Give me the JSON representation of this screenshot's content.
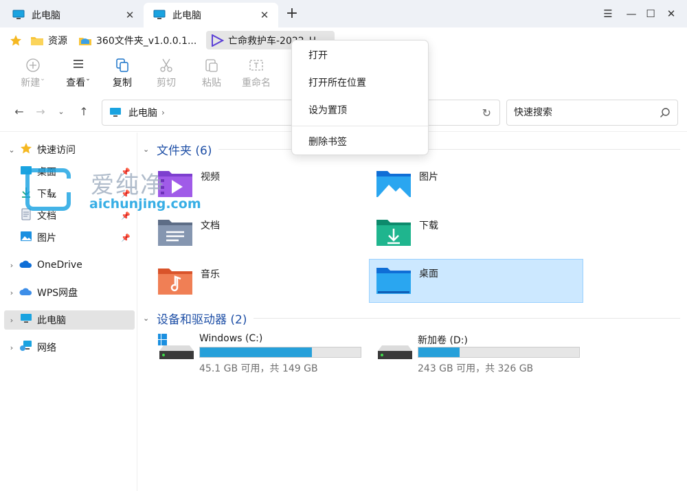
{
  "tabs": [
    {
      "label": "此电脑",
      "close": "✕"
    },
    {
      "label": "此电脑",
      "close": "✕"
    }
  ],
  "new_tab": "+",
  "window_controls": {
    "menu": "☰",
    "minimize": "—",
    "maximize": "☐",
    "close": "✕"
  },
  "bookmarks": [
    {
      "label": "资源",
      "icon": "folder-icon"
    },
    {
      "label": "360文件夹_v1.0.0.1...",
      "icon": "drive-folder-icon"
    },
    {
      "label": "亡命救护车-2022_H...",
      "icon": "video-icon"
    }
  ],
  "toolbar": {
    "new": "新建",
    "view": "查看",
    "copy": "复制",
    "cut": "剪切",
    "paste": "粘贴",
    "rename": "重命名"
  },
  "address": {
    "location": "此电脑",
    "separator": "›"
  },
  "search": {
    "placeholder": "快速搜索"
  },
  "sidebar": {
    "quick_access": "快速访问",
    "pinned": [
      {
        "label": "桌面"
      },
      {
        "label": "下载"
      },
      {
        "label": "文档"
      },
      {
        "label": "图片"
      }
    ],
    "onedrive": "OneDrive",
    "wps": "WPS网盘",
    "this_pc": "此电脑",
    "network": "网络"
  },
  "folders_section": {
    "title": "文件夹 (6)"
  },
  "folders": [
    {
      "name": "视频",
      "color": "#8c4bd9"
    },
    {
      "name": "图片",
      "color": "#1a8fe0"
    },
    {
      "name": "文档",
      "color": "#6d7f99"
    },
    {
      "name": "下载",
      "color": "#16a085"
    },
    {
      "name": "音乐",
      "color": "#e8673b"
    },
    {
      "name": "桌面",
      "color": "#1a8fe0"
    }
  ],
  "drives_section": {
    "title": "设备和驱动器 (2)"
  },
  "drives": [
    {
      "name": "Windows (C:)",
      "free_text": "45.1 GB 可用，共 149 GB",
      "used_fraction": 0.697
    },
    {
      "name": "新加卷 (D:)",
      "free_text": "243 GB 可用，共 326 GB",
      "used_fraction": 0.255
    }
  ],
  "context_menu": {
    "open": "打开",
    "open_location": "打开所在位置",
    "pin_top": "设为置顶",
    "delete_bookmark": "删除书签"
  },
  "watermark": {
    "big": "爱纯净",
    "small": "aichunjing.com"
  },
  "colors": {
    "accent": "#1e4fa6",
    "selection": "#cce8ff",
    "drive_bar": "#26a0da"
  }
}
